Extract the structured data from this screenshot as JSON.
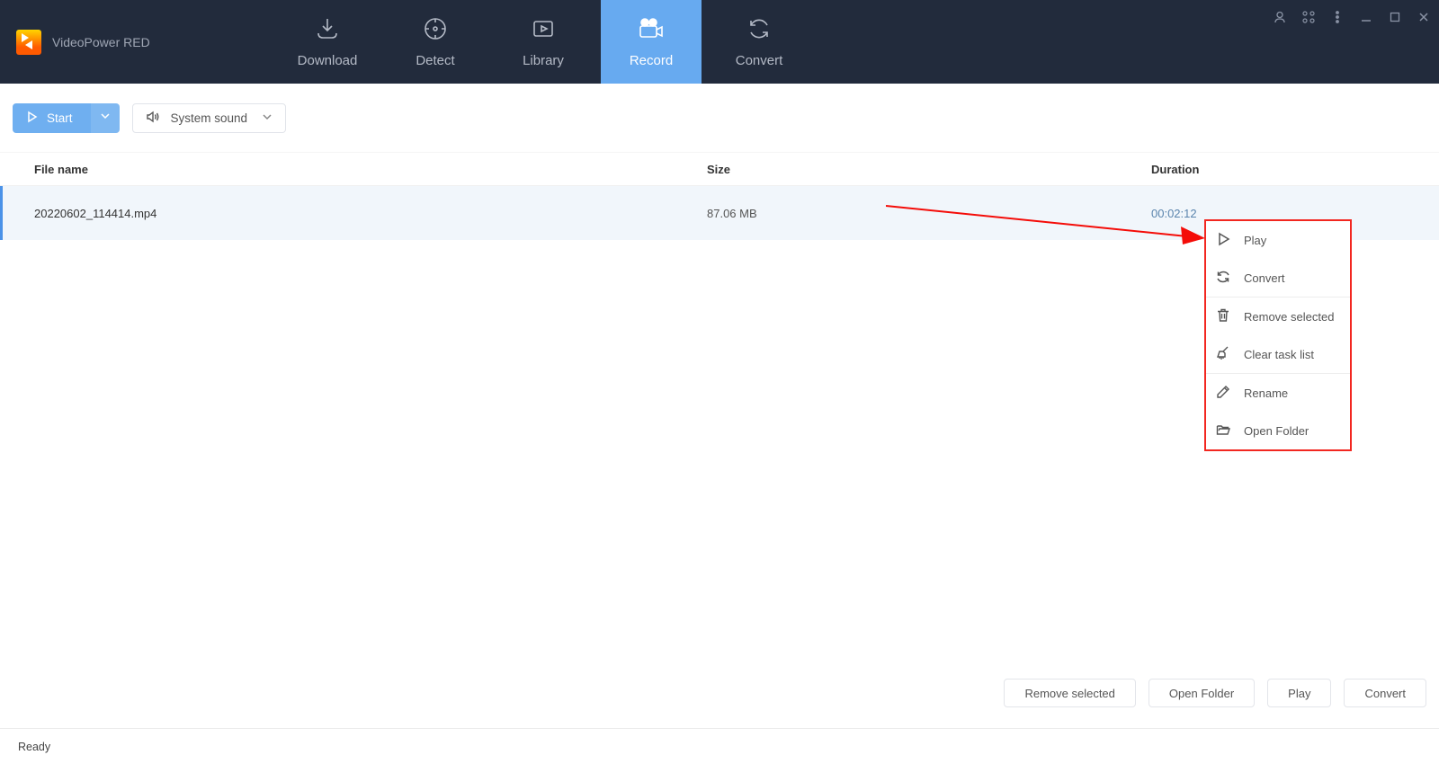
{
  "app": {
    "title": "VideoPower RED"
  },
  "nav": {
    "download": "Download",
    "detect": "Detect",
    "library": "Library",
    "record": "Record",
    "convert": "Convert"
  },
  "toolbar": {
    "start_label": "Start",
    "sound_label": "System sound"
  },
  "table": {
    "headers": {
      "name": "File name",
      "size": "Size",
      "duration": "Duration"
    },
    "rows": [
      {
        "name": "20220602_114414.mp4",
        "size": "87.06 MB",
        "duration": "00:02:12"
      }
    ]
  },
  "context_menu": {
    "play": "Play",
    "convert": "Convert",
    "remove_selected": "Remove selected",
    "clear_task": "Clear task list",
    "rename": "Rename",
    "open_folder": "Open Folder"
  },
  "footer": {
    "remove_selected": "Remove selected",
    "open_folder": "Open Folder",
    "play": "Play",
    "convert": "Convert"
  },
  "status": {
    "text": "Ready"
  }
}
